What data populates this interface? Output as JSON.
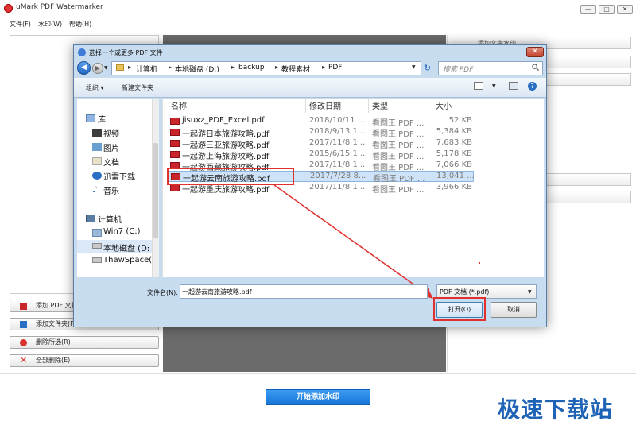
{
  "app": {
    "title": "uMark PDF Watermarker",
    "menu": [
      "文件(F)",
      "水印(W)",
      "帮助(H)"
    ],
    "window_buttons": [
      "—",
      "▢",
      "✕"
    ],
    "left_buttons": [
      {
        "label": "添加 PDF 文件",
        "icon": "pdf-add-icon"
      },
      {
        "label": "添加文件夹(F)",
        "icon": "folder-icon"
      },
      {
        "label": "删除所选(R)",
        "icon": "remove-icon"
      },
      {
        "label": "全部删除(E)",
        "icon": "delete-all-icon"
      }
    ],
    "right_first_slot": "添加文字水印",
    "start_button": "开始添加水印",
    "site_logo": "极速下载站"
  },
  "dialog": {
    "title": "选择一个或更多 PDF 文件",
    "close": "✕",
    "address": [
      "计算机",
      "本地磁盘 (D:)",
      "backup",
      "教程素材",
      "PDF"
    ],
    "search_placeholder": "搜索 PDF",
    "toolbar": {
      "organize": "组织 ▾",
      "new_folder": "新建文件夹"
    },
    "nav": {
      "library": "库",
      "library_items": [
        "视频",
        "图片",
        "文档",
        "迅雷下载",
        "音乐"
      ],
      "computer": "计算机",
      "computer_items": [
        "Win7 (C:)",
        "本地磁盘 (D:",
        "ThawSpace("
      ]
    },
    "columns": [
      "名称",
      "修改日期",
      "类型",
      "大小"
    ],
    "files": [
      {
        "name": "jisuxz_PDF_Excel.pdf",
        "date": "2018/10/11 ...",
        "type": "看图王 PDF ...",
        "size": "52 KB"
      },
      {
        "name": "一起游日本旅游攻略.pdf",
        "date": "2018/9/13 1...",
        "type": "看图王 PDF ...",
        "size": "5,384 KB"
      },
      {
        "name": "一起游三亚旅游攻略.pdf",
        "date": "2017/11/8 1...",
        "type": "看图王 PDF ...",
        "size": "7,683 KB"
      },
      {
        "name": "一起游上海旅游攻略.pdf",
        "date": "2015/6/15 1...",
        "type": "看图王 PDF ...",
        "size": "5,178 KB"
      },
      {
        "name": "一起游西藏旅游攻略.pdf",
        "date": "2017/11/8 1...",
        "type": "看图王 PDF ...",
        "size": "7,066 KB"
      },
      {
        "name": "一起游云南旅游攻略.pdf",
        "date": "2017/7/28 8...",
        "type": "看图王 PDF ...",
        "size": "13,041 ..."
      },
      {
        "name": "一起游重庆旅游攻略.pdf",
        "date": "2017/11/8 1...",
        "type": "看图王 PDF ...",
        "size": "3,966 KB"
      }
    ],
    "filename_label": "文件名(N):",
    "filename_value": "一起游云南旅游攻略.pdf",
    "filetype": "PDF 文档 (*.pdf)",
    "open_button": "打开(O)",
    "cancel_button": "取消"
  }
}
